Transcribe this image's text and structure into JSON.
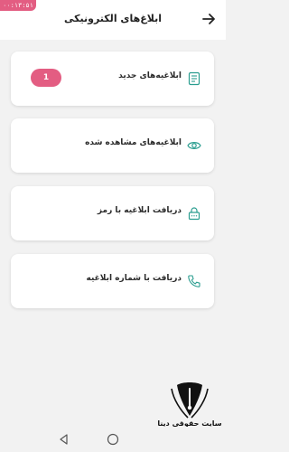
{
  "status": {
    "time": "۰۰:۱۳:۵۱"
  },
  "header": {
    "title": "ابلاغ‌های الکترونیکی"
  },
  "cards": [
    {
      "label": "ابلاغیه‌های جدید",
      "icon": "document-icon",
      "badge": "1"
    },
    {
      "label": "ابلاغیه‌های مشاهده شده",
      "icon": "eye-icon"
    },
    {
      "label": "دریافت ابلاغیه با رمز",
      "icon": "lock-icon"
    },
    {
      "label": "دریافت با شماره ابلاغیه",
      "icon": "phone-icon"
    }
  ],
  "watermark": {
    "text": "سایت حقوقی دینا"
  },
  "colors": {
    "accent": "#e35d82",
    "icon": "#2a9d8f"
  }
}
